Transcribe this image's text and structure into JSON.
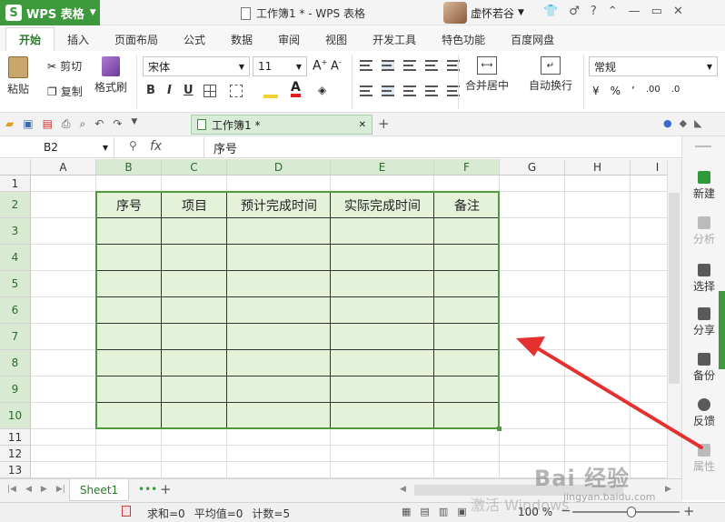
{
  "app": {
    "name": "WPS 表格",
    "logo": "S",
    "doc_title": "工作簿1 * - WPS 表格",
    "user": "虚怀若谷"
  },
  "tabs": [
    "开始",
    "插入",
    "页面布局",
    "公式",
    "数据",
    "审阅",
    "视图",
    "开发工具",
    "特色功能",
    "百度网盘"
  ],
  "ribbon": {
    "paste": "粘贴",
    "cut": "剪切",
    "copy": "复制",
    "format_painter": "格式刷",
    "font_name": "宋体",
    "font_size": "11",
    "bold": "B",
    "italic": "I",
    "underline": "U",
    "merge_center": "合并居中",
    "wrap_text": "自动换行",
    "number_format": "常规",
    "percent": "%",
    "comma": "’",
    "dec_inc": ".00",
    "dec_dec": ".0"
  },
  "doc_tab": {
    "label": "工作簿1 *"
  },
  "formula_bar": {
    "cell_ref": "B2",
    "fx": "fx",
    "value": "序号"
  },
  "grid": {
    "columns": [
      "A",
      "B",
      "C",
      "D",
      "E",
      "F",
      "G",
      "H",
      "I"
    ],
    "rows": [
      "1",
      "2",
      "3",
      "4",
      "5",
      "6",
      "7",
      "8",
      "9",
      "10",
      "11",
      "12",
      "13"
    ],
    "table_headers": [
      "序号",
      "项目",
      "预计完成时间",
      "实际完成时间",
      "备注"
    ]
  },
  "side_panel": [
    "新建",
    "分析",
    "选择",
    "分享",
    "备份",
    "反馈",
    "属性"
  ],
  "sheet_tab": "Sheet1",
  "status": {
    "sum": "求和=0",
    "avg": "平均值=0",
    "count": "计数=5",
    "zoom": "100 %"
  },
  "watermark": {
    "text": "Bai 经验",
    "url": "jingyan.baidu.com",
    "activate": "激活 Windows"
  },
  "colors": {
    "accent": "#3c9a3c",
    "table_fill": "#e3f2d9",
    "selection_border": "#4f9a3c",
    "arrow": "#e53030"
  }
}
